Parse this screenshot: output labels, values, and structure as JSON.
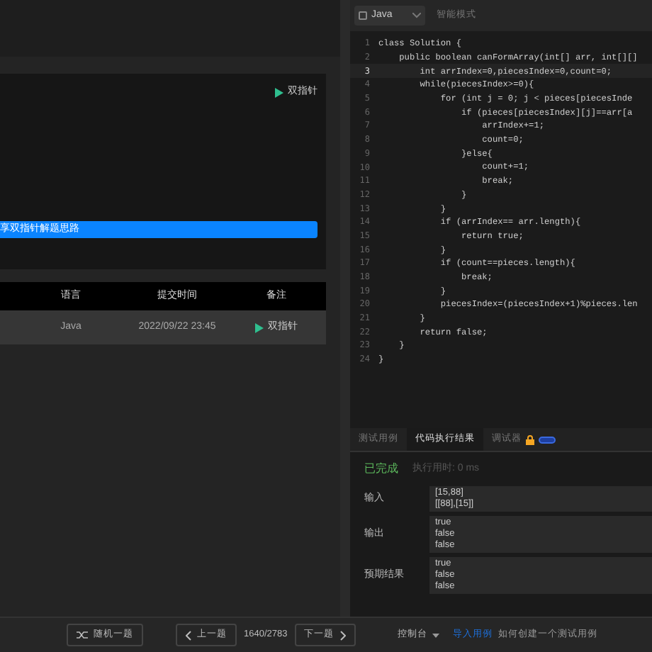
{
  "description_panel": {
    "tag": "双指针",
    "share_button": "享双指针解题思路"
  },
  "submissions": {
    "columns": [
      "语言",
      "提交时间",
      "备注"
    ],
    "rows": [
      {
        "language": "Java",
        "time": "2022/09/22 23:45",
        "note": "双指针"
      }
    ]
  },
  "editor": {
    "language": "Java",
    "mode": "智能模式",
    "line_numbers": [
      "1",
      "2",
      "3",
      "4",
      "5",
      "6",
      "7",
      "8",
      "9",
      "10",
      "11",
      "12",
      "13",
      "14",
      "15",
      "16",
      "17",
      "18",
      "19",
      "20",
      "21",
      "22",
      "23",
      "24"
    ],
    "current": [
      false,
      false,
      true,
      false,
      false,
      false,
      false,
      false,
      false,
      false,
      false,
      false,
      false,
      false,
      false,
      false,
      false,
      false,
      false,
      false,
      false,
      false,
      false,
      false
    ],
    "lines": [
      "class Solution {",
      "    public boolean canFormArray(int[] arr, int[][]",
      "        int arrIndex=0,piecesIndex=0,count=0;",
      "        while(piecesIndex>=0){",
      "            for (int j = 0; j < pieces[piecesInde",
      "                if (pieces[piecesIndex][j]==arr[a",
      "                    arrIndex+=1;",
      "                    count=0;",
      "                }else{",
      "                    count+=1;",
      "                    break;",
      "                }",
      "            }",
      "            if (arrIndex== arr.length){",
      "                return true;",
      "            }",
      "            if (count==pieces.length){",
      "                break;",
      "            }",
      "            piecesIndex=(piecesIndex+1)%pieces.len",
      "        }",
      "        return false;",
      "    }",
      "}"
    ]
  },
  "result_panel": {
    "tabs": [
      {
        "label": "测试用例",
        "selected": false
      },
      {
        "label": "代码执行结果",
        "selected": true
      },
      {
        "label": "调试器",
        "selected": false
      }
    ],
    "status": "已完成",
    "runtime": "执行用时: 0 ms",
    "rows": [
      {
        "label": "输入",
        "lines": [
          "[15,88]",
          "[[88],[15]]"
        ]
      },
      {
        "label": "输出",
        "lines": [
          "true",
          "false",
          "false"
        ]
      },
      {
        "label": "预期结果",
        "lines": [
          "true",
          "false",
          "false"
        ]
      }
    ]
  },
  "footer": {
    "random": "随机一题",
    "prev": "上一题",
    "counter": "1640/2783",
    "next": "下一题",
    "console": "控制台",
    "import": "导入用例",
    "help": "如何创建一个测试用例"
  }
}
